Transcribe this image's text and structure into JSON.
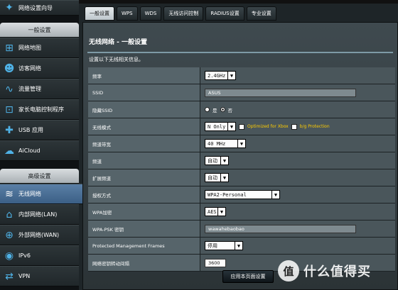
{
  "sidebar": {
    "setup_wizard": "网络设置向导",
    "general_header": "一般设置",
    "general_items": [
      {
        "label": "网络地图",
        "icon": "network-map-icon",
        "glyph": "⊞"
      },
      {
        "label": "访客网络",
        "icon": "guest-network-icon",
        "glyph": "☻"
      },
      {
        "label": "流量管理",
        "icon": "traffic-manager-icon",
        "glyph": "∿"
      },
      {
        "label": "家长电脑控制程序",
        "icon": "parental-control-icon",
        "glyph": "⊡"
      },
      {
        "label": "USB 应用",
        "icon": "usb-puzzle-icon",
        "glyph": "✚"
      },
      {
        "label": "AiCloud",
        "icon": "cloud-icon",
        "glyph": "☁"
      }
    ],
    "advanced_header": "高级设置",
    "advanced_items": [
      {
        "label": "无线网络",
        "icon": "wireless-icon",
        "glyph": "≋",
        "active": true
      },
      {
        "label": "内部网络(LAN)",
        "icon": "home-icon",
        "glyph": "⌂"
      },
      {
        "label": "外部网络(WAN)",
        "icon": "globe-icon",
        "glyph": "⊕"
      },
      {
        "label": "IPv6",
        "icon": "ipv6-icon",
        "glyph": "◉"
      },
      {
        "label": "VPN",
        "icon": "vpn-icon",
        "glyph": "⇄"
      }
    ]
  },
  "tabs": [
    {
      "label": "一般设置",
      "active": true
    },
    {
      "label": "WPS"
    },
    {
      "label": "WDS"
    },
    {
      "label": "无线访问控制"
    },
    {
      "label": "RADIUS设置"
    },
    {
      "label": "专业设置"
    }
  ],
  "panel": {
    "title": "无线网络 - 一般设置",
    "description": "设置以下无线相关信息。"
  },
  "form": {
    "band": {
      "label": "频率",
      "value": "2.4GHz"
    },
    "ssid": {
      "label": "SSID",
      "value": "ASUS"
    },
    "hide_ssid": {
      "label": "隐藏SSID",
      "yes": "是",
      "no": "否",
      "selected": "否"
    },
    "wireless_mode": {
      "label": "无线模式",
      "value": "N Only",
      "xbox_label": "Optimized for Xbox",
      "bg_label": "b/g Protection"
    },
    "bandwidth": {
      "label": "频道带宽",
      "value": "40 MHz"
    },
    "channel": {
      "label": "频道",
      "value": "自动"
    },
    "ext_channel": {
      "label": "扩展频道",
      "value": "自动"
    },
    "auth_method": {
      "label": "授权方式",
      "value": "WPA2-Personal"
    },
    "wpa_encryption": {
      "label": "WPA加密",
      "value": "AES"
    },
    "wpa_psk": {
      "label": "WPA-PSK 密钥",
      "value": "wawahebaobao"
    },
    "pmf": {
      "label": "Protected Management Frames",
      "value": "停用"
    },
    "key_rotation": {
      "label": "网络密钥转动间隔",
      "value": "3600"
    }
  },
  "apply_button": "应用本页面设置",
  "watermark": {
    "logo": "值",
    "text": "什么值得买"
  },
  "colors": {
    "accent": "#4fb2e6",
    "active_nav": "#3b5f85",
    "warning_text": "#ffcc00"
  }
}
